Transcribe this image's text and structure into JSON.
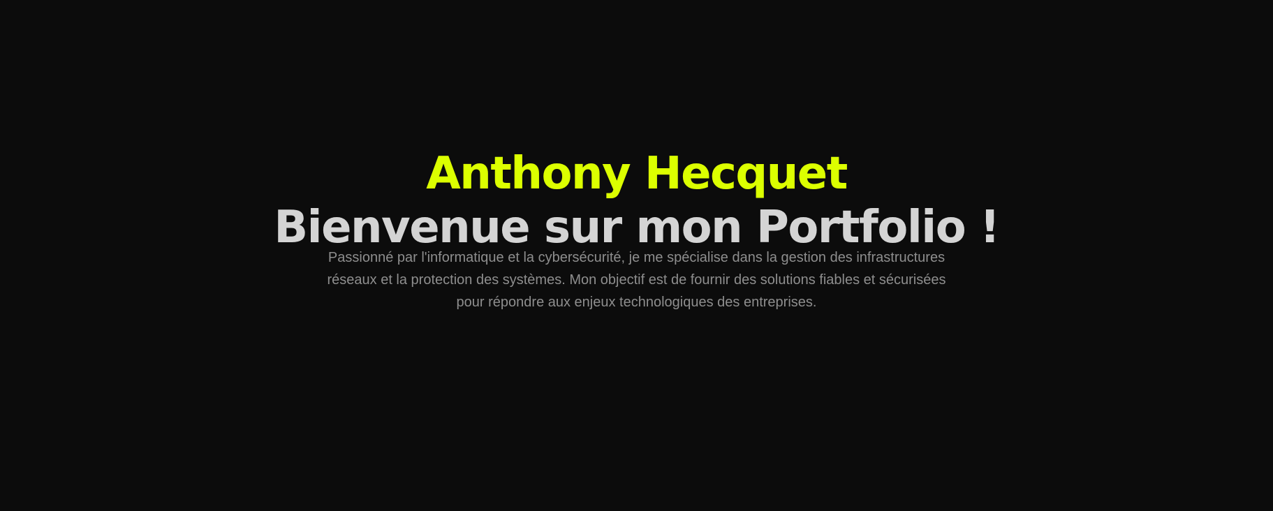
{
  "hero": {
    "name": "Anthony Hecquet",
    "title": "Bienvenue sur mon Portfolio !",
    "intro_lines": [
      "Passionné par l'informatique et la cybersécurité, je me spécialise dans la gestion des infrastructures",
      "réseaux et la protection des systèmes. Mon objectif est de fournir des solutions fiables et sécurisées",
      "pour répondre aux enjeux technologiques des entreprises."
    ]
  },
  "colors": {
    "background": "#0c0c0c",
    "accent": "#dcff00",
    "heading": "#d4d4d4",
    "body_text": "#8e8e8e"
  }
}
